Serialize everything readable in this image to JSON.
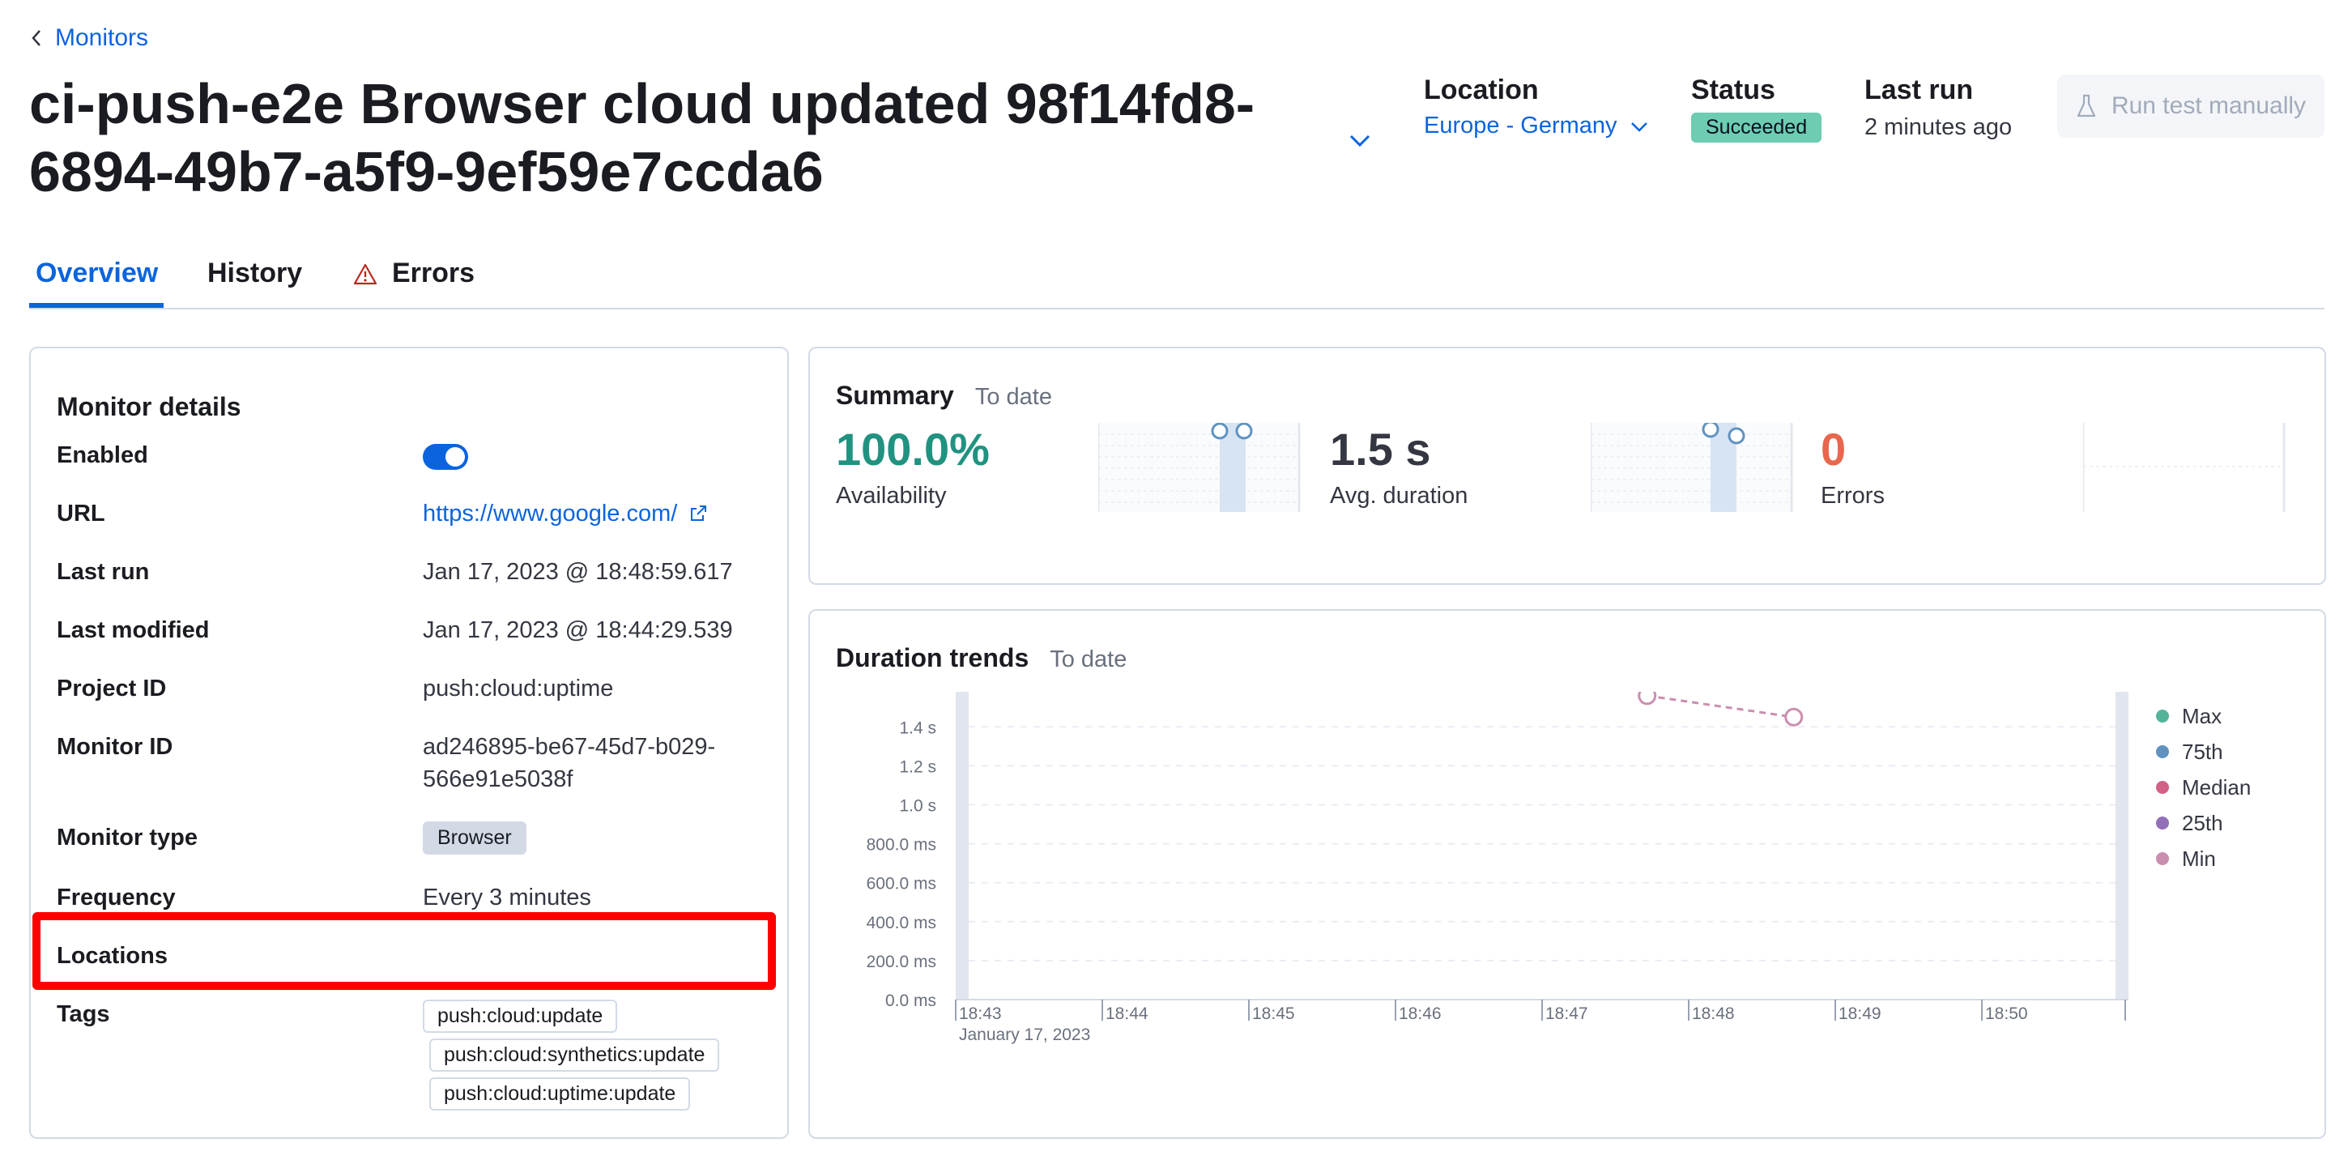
{
  "header": {
    "back_label": "Monitors",
    "title": "ci-push-e2e Browser cloud updated 98f14fd8-6894-49b7-a5f9-9ef59e7ccda6",
    "location_label": "Location",
    "location_value": "Europe - Germany",
    "status_label": "Status",
    "status_value": "Succeeded",
    "last_run_label": "Last run",
    "last_run_value": "2 minutes ago",
    "run_test_label": "Run test manually"
  },
  "tabs": [
    {
      "label": "Overview",
      "active": true
    },
    {
      "label": "History",
      "active": false
    },
    {
      "label": "Errors",
      "active": false
    }
  ],
  "details": {
    "title": "Monitor details",
    "enabled_label": "Enabled",
    "enabled": true,
    "url_label": "URL",
    "url_value": "https://www.google.com/",
    "last_run_label": "Last run",
    "last_run_value": "Jan 17, 2023 @ 18:48:59.617",
    "last_modified_label": "Last modified",
    "last_modified_value": "Jan 17, 2023 @ 18:44:29.539",
    "project_id_label": "Project ID",
    "project_id_value": "push:cloud:uptime",
    "monitor_id_label": "Monitor ID",
    "monitor_id_line1": "ad246895-be67-45d7-b029-",
    "monitor_id_line2": "566e91e5038f",
    "monitor_type_label": "Monitor type",
    "monitor_type_value": "Browser",
    "frequency_label": "Frequency",
    "frequency_value": "Every 3 minutes",
    "locations_label": "Locations",
    "tags_label": "Tags",
    "tags": [
      "push:cloud:update",
      "push:cloud:synthetics:update",
      "push:cloud:uptime:update"
    ]
  },
  "summary": {
    "title": "Summary",
    "subtitle": "To date",
    "availability_value": "100.0%",
    "availability_label": "Availability",
    "duration_value": "1.5 s",
    "duration_label": "Avg. duration",
    "errors_value": "0",
    "errors_label": "Errors"
  },
  "trends": {
    "title": "Duration trends",
    "subtitle": "To date"
  },
  "colors": {
    "accent": "#0b64dd",
    "success": "#6dccb1",
    "availability": "#209280",
    "errors": "#e7664c",
    "highlight": "#ff0000"
  },
  "chart_data": {
    "type": "line",
    "x": [
      "18:47:43",
      "18:48:43"
    ],
    "series": [
      {
        "name": "Min",
        "values": [
          1.56,
          1.45
        ]
      }
    ],
    "legend": [
      "Max",
      "75th",
      "Median",
      "25th",
      "Min"
    ],
    "legend_colors": [
      "#54b399",
      "#6092c0",
      "#d36086",
      "#9170b8",
      "#ca8eae"
    ],
    "y_ticks": [
      "0.0 ms",
      "200.0 ms",
      "400.0 ms",
      "600.0 ms",
      "800.0 ms",
      "1.0 s",
      "1.2 s",
      "1.4 s"
    ],
    "y_tick_values": [
      0,
      0.2,
      0.4,
      0.6,
      0.8,
      1.0,
      1.2,
      1.4
    ],
    "x_ticks": [
      "18:43",
      "18:44",
      "18:45",
      "18:46",
      "18:47",
      "18:48",
      "18:49",
      "18:50"
    ],
    "x_sub_label": "January 17, 2023",
    "x_range": [
      "18:43",
      "18:51"
    ],
    "ylim": [
      0,
      1.58
    ],
    "legend_position": "right",
    "grid": true
  }
}
